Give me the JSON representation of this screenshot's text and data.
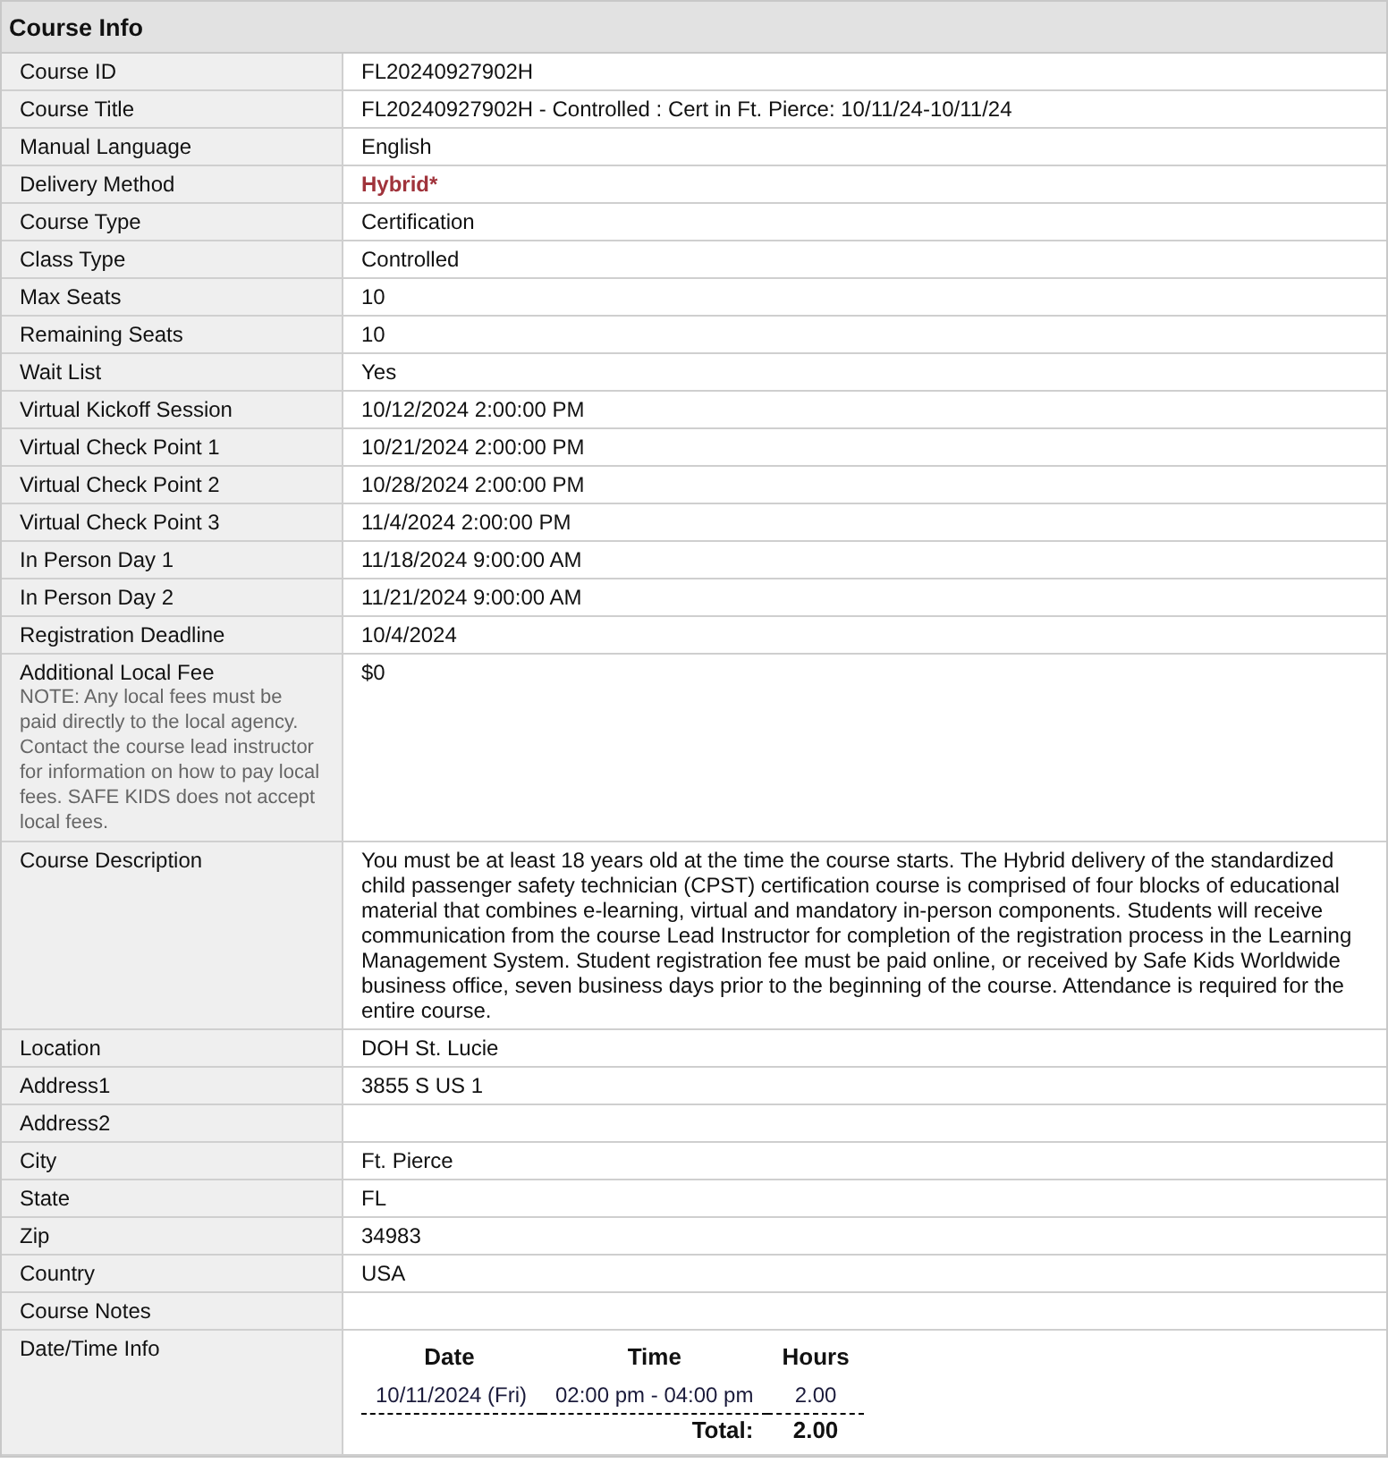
{
  "title": "Course Info",
  "rows": [
    {
      "label": "Course ID",
      "value": "FL20240927902H",
      "kind": "text"
    },
    {
      "label": "Course Title",
      "value": "FL20240927902H - Controlled : Cert in Ft. Pierce: 10/11/24-10/11/24",
      "kind": "text"
    },
    {
      "label": "Manual Language",
      "value": "English",
      "kind": "text"
    },
    {
      "label": "Delivery Method",
      "value": "Hybrid*",
      "kind": "highlight"
    },
    {
      "label": "Course Type",
      "value": "Certification",
      "kind": "text"
    },
    {
      "label": "Class Type",
      "value": "Controlled",
      "kind": "text"
    },
    {
      "label": "Max Seats",
      "value": "10",
      "kind": "text"
    },
    {
      "label": "Remaining Seats",
      "value": "10",
      "kind": "text"
    },
    {
      "label": "Wait List",
      "value": "Yes",
      "kind": "text"
    },
    {
      "label": "Virtual Kickoff Session",
      "value": "10/12/2024 2:00:00 PM",
      "kind": "text"
    },
    {
      "label": "Virtual Check Point 1",
      "value": "10/21/2024 2:00:00 PM",
      "kind": "text"
    },
    {
      "label": "Virtual Check Point 2",
      "value": "10/28/2024 2:00:00 PM",
      "kind": "text"
    },
    {
      "label": "Virtual Check Point 3",
      "value": "11/4/2024 2:00:00 PM",
      "kind": "text"
    },
    {
      "label": "In Person Day 1",
      "value": "11/18/2024 9:00:00 AM",
      "kind": "text"
    },
    {
      "label": "In Person Day 2",
      "value": "11/21/2024 9:00:00 AM",
      "kind": "text"
    },
    {
      "label": "Registration Deadline",
      "value": "10/4/2024",
      "kind": "text"
    },
    {
      "label": "Additional Local Fee",
      "note": "NOTE: Any local fees must be paid directly to the local agency. Contact the course lead instructor for information on how to pay local fees. SAFE KIDS does not accept local fees.",
      "value": "$0",
      "kind": "text"
    },
    {
      "label": "Course Description",
      "value": "You must be at least 18 years old at the time the course starts. The Hybrid delivery of the standardized child passenger safety technician (CPST) certification course is comprised of four blocks of educational material that combines e-learning, virtual and mandatory in-person components. Students will receive communication from the course Lead Instructor for completion of the registration process in the Learning Management System. Student registration fee must be paid online, or received by Safe Kids Worldwide business office, seven business days prior to the beginning of the course. Attendance is required for the entire course.",
      "kind": "text"
    },
    {
      "label": "Location",
      "value": "DOH St. Lucie",
      "kind": "text"
    },
    {
      "label": "Address1",
      "value": "3855 S US 1",
      "kind": "text"
    },
    {
      "label": "Address2",
      "kind": "text"
    },
    {
      "label": "City",
      "value": "Ft. Pierce",
      "kind": "text"
    },
    {
      "label": "State",
      "value": "FL",
      "kind": "text"
    },
    {
      "label": "Zip",
      "value": "34983",
      "kind": "text"
    },
    {
      "label": "Country",
      "value": "USA",
      "kind": "text"
    },
    {
      "label": "Course Notes",
      "kind": "text"
    },
    {
      "label": "Date/Time Info",
      "kind": "schedule",
      "schedule": {
        "columns": [
          "Date",
          "Time",
          "Hours"
        ],
        "sessions": [
          {
            "date": "10/11/2024 (Fri)",
            "time": "02:00 pm - 04:00 pm",
            "hours": "2.00"
          }
        ],
        "total_label": "Total:",
        "total": "2.00"
      }
    }
  ]
}
